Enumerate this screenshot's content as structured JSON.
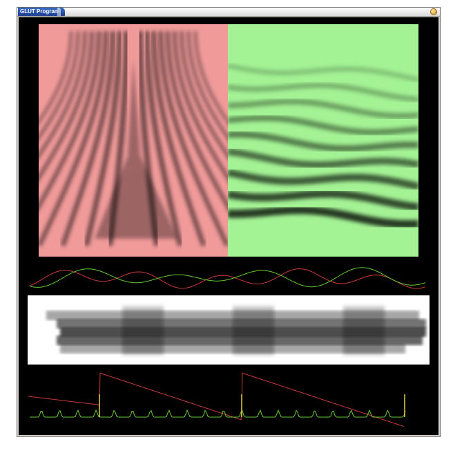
{
  "window": {
    "title": "GLUT Program"
  },
  "colors": {
    "background": "#000000",
    "red_panel": "#f19a9a",
    "green_panel": "#a3f294",
    "red_curve": "#cc3b3b",
    "green_curve": "#66cc33",
    "yellow_curve": "#e0d040",
    "spectrogram_bg": "#ffffff",
    "window_chrome": "#d4d0c8",
    "title_tab": "#2a55b0"
  },
  "icons": {
    "close": "close-icon"
  }
}
